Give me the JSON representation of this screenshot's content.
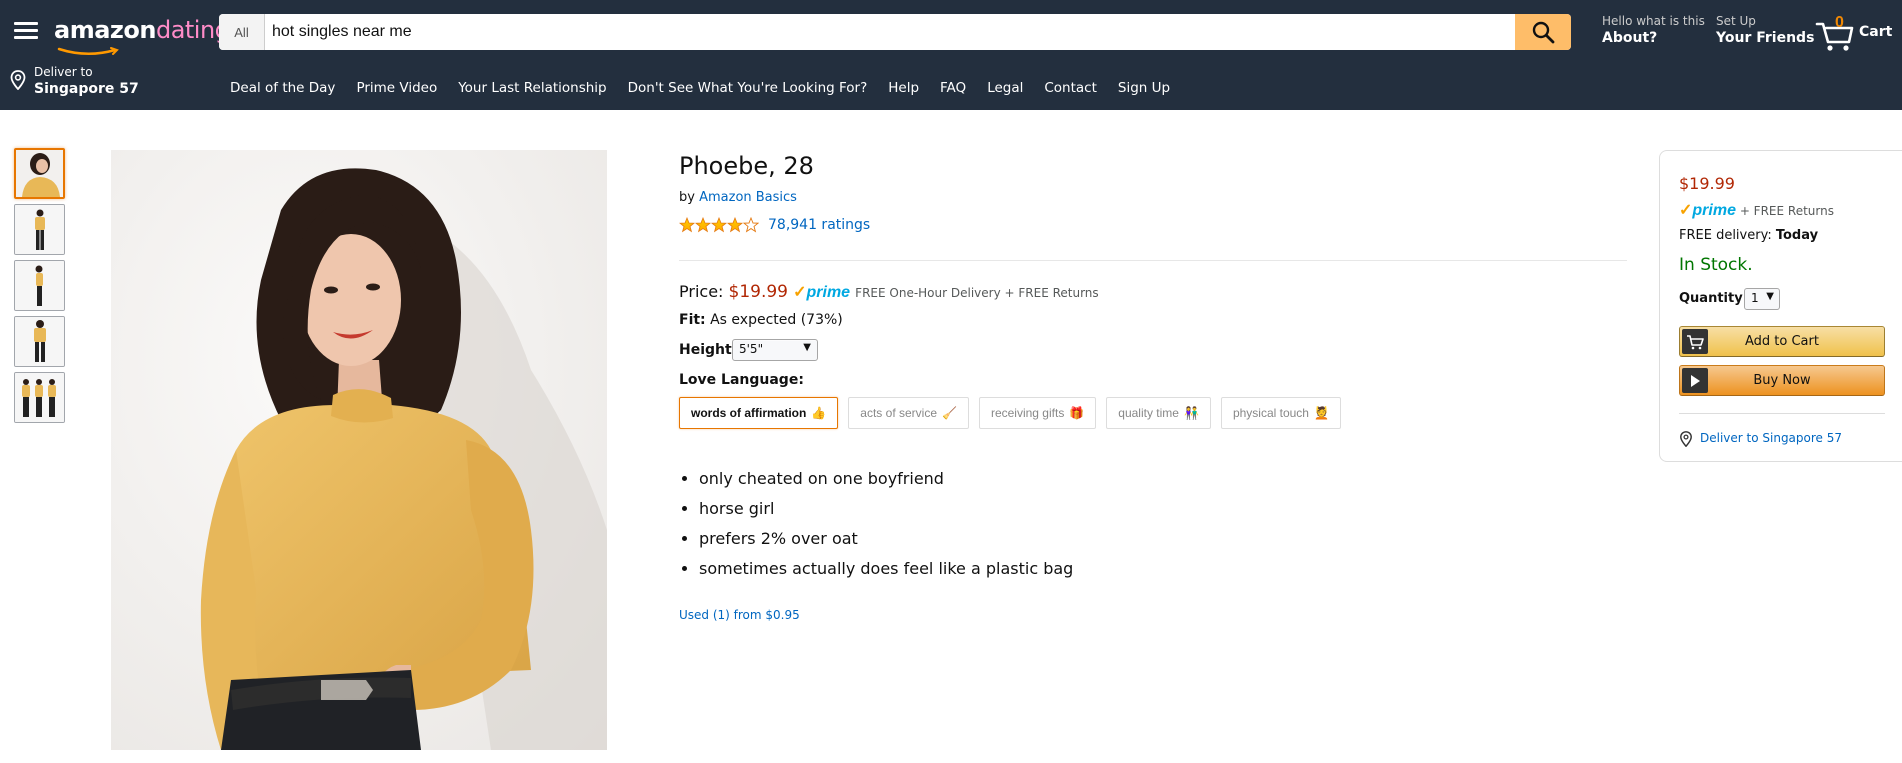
{
  "header": {
    "logo_primary": "amazon",
    "logo_secondary": "dating",
    "search": {
      "category": "All",
      "query": "hot singles near me"
    },
    "account": {
      "line1": "Hello what is this",
      "line2": "About?"
    },
    "setup": {
      "line1": "Set Up",
      "line2": "Your Friends"
    },
    "cart": {
      "count": "0",
      "label": "Cart"
    },
    "deliver": {
      "line1": "Deliver to",
      "line2": "Singapore 57"
    },
    "subnav": [
      "Deal of the Day",
      "Prime Video",
      "Your Last Relationship",
      "Don't See What You're Looking For?",
      "Help",
      "FAQ",
      "Legal",
      "Contact",
      "Sign Up"
    ]
  },
  "product": {
    "title": "Phoebe, 28",
    "by_prefix": "by",
    "brand": "Amazon Basics",
    "rating_stars": 4,
    "ratings_count": "78,941 ratings",
    "price_label": "Price:",
    "price": "$19.99",
    "prime": "prime",
    "shipping": "FREE One-Hour Delivery + FREE Returns",
    "fit_label": "Fit:",
    "fit_value": "As expected (73%)",
    "height_label": "Height:",
    "height_value": "5'5\"",
    "love_language_label": "Love Language:",
    "love_languages": [
      {
        "label": "words of affirmation",
        "emoji": "👍",
        "selected": true
      },
      {
        "label": "acts of service",
        "emoji": "🧹",
        "selected": false
      },
      {
        "label": "receiving gifts",
        "emoji": "🎁",
        "selected": false
      },
      {
        "label": "quality time",
        "emoji": "👫",
        "selected": false
      },
      {
        "label": "physical touch",
        "emoji": "💆",
        "selected": false
      }
    ],
    "bullets": [
      "only cheated on one boyfriend",
      "horse girl",
      "prefers 2% over oat",
      "sometimes actually does feel like a plastic bag"
    ],
    "used_offer": "Used (1) from $0.95"
  },
  "buybox": {
    "price": "$19.99",
    "prime": "prime",
    "returns": "+ FREE Returns",
    "delivery_prefix": "FREE delivery:",
    "delivery_day": "Today",
    "stock": "In Stock.",
    "quantity_label": "Quantity:",
    "quantity_value": "1",
    "add_to_cart": "Add to Cart",
    "buy_now": "Buy Now",
    "deliver_to": "Deliver to Singapore 57"
  },
  "colors": {
    "nav_bg": "#232f3e",
    "search_btn": "#febd69",
    "price": "#b12704",
    "link": "#0066c0",
    "in_stock": "#007600",
    "selected_outline": "#e77600",
    "sweater": "#e8b857"
  }
}
